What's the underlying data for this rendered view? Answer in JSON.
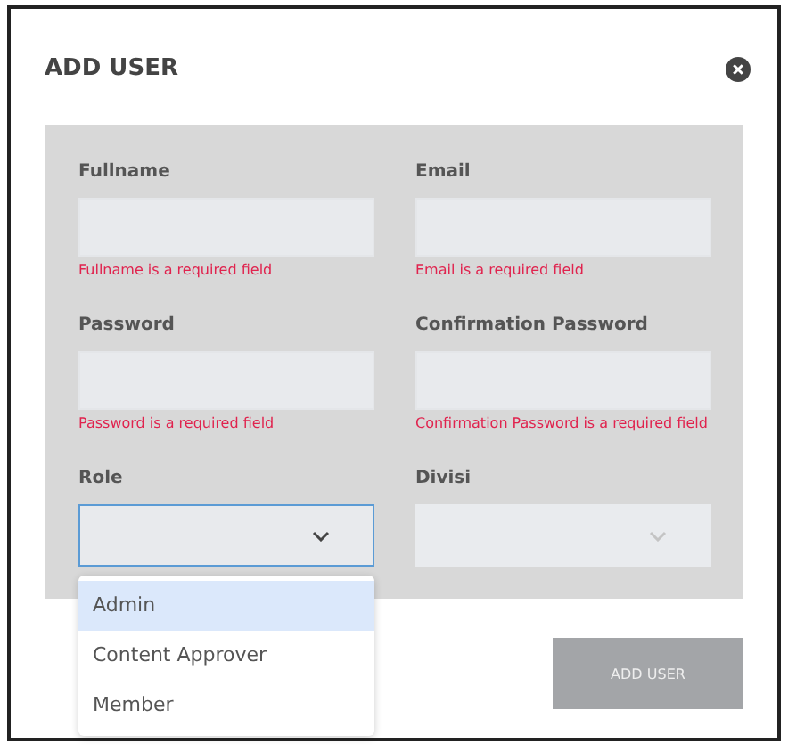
{
  "dialog": {
    "title": "ADD USER"
  },
  "fields": [
    {
      "label": "Fullname",
      "kind": "text",
      "error": "Fullname is a required field",
      "focused": false,
      "disabled": false
    },
    {
      "label": "Email",
      "kind": "text",
      "error": "Email is a required field",
      "focused": false,
      "disabled": false
    },
    {
      "label": "Password",
      "kind": "text",
      "error": "Password is a required field",
      "focused": false,
      "disabled": false
    },
    {
      "label": "Confirmation Password",
      "kind": "text",
      "error": "Confirmation Password is a required field",
      "focused": false,
      "disabled": false
    },
    {
      "label": "Role",
      "kind": "select",
      "focused": true,
      "disabled": false
    },
    {
      "label": "Divisi",
      "kind": "select",
      "focused": false,
      "disabled": true
    }
  ],
  "dropdown": {
    "options": [
      {
        "label": "Admin",
        "selected": true
      },
      {
        "label": "Content Approver",
        "selected": false
      },
      {
        "label": "Member",
        "selected": false
      }
    ]
  },
  "submit": {
    "label": "ADD USER",
    "disabled": true
  }
}
